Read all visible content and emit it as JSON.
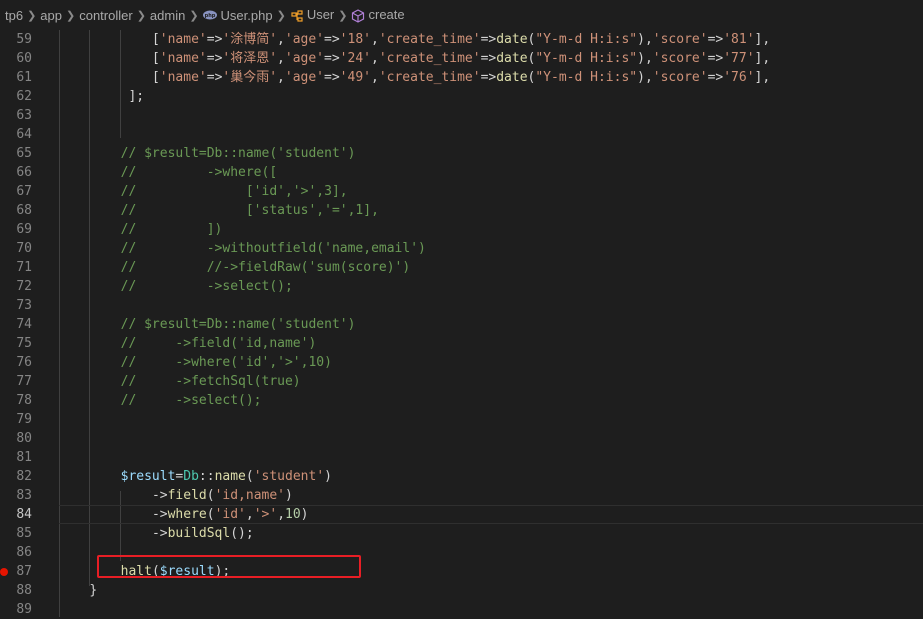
{
  "breadcrumb": {
    "items": [
      "tp6",
      "app",
      "controller",
      "admin",
      "User.php",
      "User",
      "create"
    ],
    "separator": ">"
  },
  "colors": {
    "background": "#1e1e1e",
    "string": "#ce9178",
    "comment": "#6a9955",
    "function": "#dcdcaa",
    "variable": "#9cdcfe",
    "class": "#4ec9b0",
    "number": "#b5cea8",
    "highlight_box": "#e81e25",
    "breakpoint": "#e51400"
  },
  "editor": {
    "active_line": "84",
    "breakpoint_line": "87",
    "lines": [
      {
        "n": "59",
        "text": "            ['name'=>'涂博简','age'=>'18','create_time'=>date(\"Y-m-d H:i:s\"),'score'=>'81'],"
      },
      {
        "n": "60",
        "text": "            ['name'=>'将泽恩','age'=>'24','create_time'=>date(\"Y-m-d H:i:s\"),'score'=>'77'],"
      },
      {
        "n": "61",
        "text": "            ['name'=>'巢今雨','age'=>'49','create_time'=>date(\"Y-m-d H:i:s\"),'score'=>'76'],"
      },
      {
        "n": "62",
        "text": "         ];"
      },
      {
        "n": "63",
        "text": ""
      },
      {
        "n": "64",
        "text": ""
      },
      {
        "n": "65",
        "text": "        // $result=Db::name('student')"
      },
      {
        "n": "66",
        "text": "        //         ->where(["
      },
      {
        "n": "67",
        "text": "        //              ['id','>',3],"
      },
      {
        "n": "68",
        "text": "        //              ['status','=',1],"
      },
      {
        "n": "69",
        "text": "        //         ])"
      },
      {
        "n": "70",
        "text": "        //         ->withoutfield('name,email')"
      },
      {
        "n": "71",
        "text": "        //         //->fieldRaw('sum(score)')"
      },
      {
        "n": "72",
        "text": "        //         ->select();"
      },
      {
        "n": "73",
        "text": ""
      },
      {
        "n": "74",
        "text": "        // $result=Db::name('student')"
      },
      {
        "n": "75",
        "text": "        //     ->field('id,name')"
      },
      {
        "n": "76",
        "text": "        //     ->where('id','>',10)"
      },
      {
        "n": "77",
        "text": "        //     ->fetchSql(true)"
      },
      {
        "n": "78",
        "text": "        //     ->select();"
      },
      {
        "n": "79",
        "text": ""
      },
      {
        "n": "80",
        "text": ""
      },
      {
        "n": "81",
        "text": ""
      },
      {
        "n": "82",
        "text": "        $result=Db::name('student')"
      },
      {
        "n": "83",
        "text": "            ->field('id,name')"
      },
      {
        "n": "84",
        "text": "            ->where('id','>',10)"
      },
      {
        "n": "85",
        "text": "            ->buildSql();"
      },
      {
        "n": "86",
        "text": ""
      },
      {
        "n": "87",
        "text": "        halt($result);"
      },
      {
        "n": "88",
        "text": "    }"
      },
      {
        "n": "89",
        "text": ""
      }
    ]
  }
}
